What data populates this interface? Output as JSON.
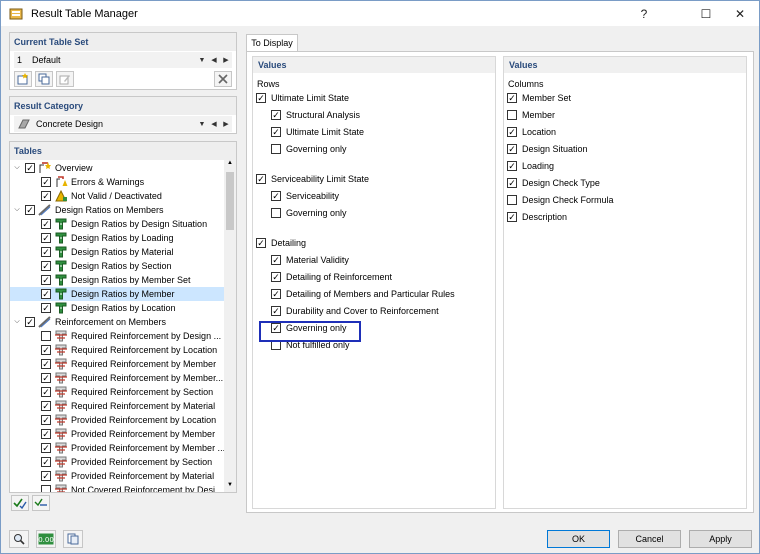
{
  "window": {
    "title": "Result Table Manager",
    "help": "?",
    "maximize": "☐",
    "close": "✕"
  },
  "current_table_set": {
    "header": "Current Table Set",
    "index": "1",
    "name": "Default"
  },
  "result_category": {
    "header": "Result Category",
    "value": "Concrete Design"
  },
  "tables": {
    "header": "Tables",
    "items": [
      {
        "label": "Overview",
        "level": 0,
        "expanded": true,
        "checked": true,
        "icon": "overview-icon"
      },
      {
        "label": "Errors & Warnings",
        "level": 1,
        "checked": true,
        "icon": "errors-warnings-icon"
      },
      {
        "label": "Not Valid / Deactivated",
        "level": 1,
        "checked": true,
        "icon": "not-valid-icon"
      },
      {
        "label": "Design Ratios on Members",
        "level": 0,
        "expanded": true,
        "checked": true,
        "icon": "member-icon"
      },
      {
        "label": "Design Ratios by Design Situation",
        "level": 1,
        "checked": true,
        "icon": "design-ratio-icon"
      },
      {
        "label": "Design Ratios by Loading",
        "level": 1,
        "checked": true,
        "icon": "design-ratio-icon"
      },
      {
        "label": "Design Ratios by Material",
        "level": 1,
        "checked": true,
        "icon": "design-ratio-icon"
      },
      {
        "label": "Design Ratios by Section",
        "level": 1,
        "checked": true,
        "icon": "design-ratio-icon"
      },
      {
        "label": "Design Ratios by Member Set",
        "level": 1,
        "checked": true,
        "icon": "design-ratio-icon"
      },
      {
        "label": "Design Ratios by Member",
        "level": 1,
        "checked": true,
        "icon": "design-ratio-icon",
        "selected": true
      },
      {
        "label": "Design Ratios by Location",
        "level": 1,
        "checked": true,
        "icon": "design-ratio-icon"
      },
      {
        "label": "Reinforcement on Members",
        "level": 0,
        "expanded": true,
        "checked": true,
        "icon": "member-icon"
      },
      {
        "label": "Required Reinforcement by Design ...",
        "level": 1,
        "checked": false,
        "icon": "reinforcement-icon"
      },
      {
        "label": "Required Reinforcement by Location",
        "level": 1,
        "checked": true,
        "icon": "reinforcement-icon"
      },
      {
        "label": "Required Reinforcement by Member",
        "level": 1,
        "checked": true,
        "icon": "reinforcement-icon"
      },
      {
        "label": "Required Reinforcement by Member...",
        "level": 1,
        "checked": true,
        "icon": "reinforcement-icon"
      },
      {
        "label": "Required Reinforcement by Section",
        "level": 1,
        "checked": true,
        "icon": "reinforcement-icon"
      },
      {
        "label": "Required Reinforcement by Material",
        "level": 1,
        "checked": true,
        "icon": "reinforcement-icon"
      },
      {
        "label": "Provided Reinforcement by Location",
        "level": 1,
        "checked": true,
        "icon": "reinforcement-icon"
      },
      {
        "label": "Provided Reinforcement by Member",
        "level": 1,
        "checked": true,
        "icon": "reinforcement-icon"
      },
      {
        "label": "Provided Reinforcement by Member ...",
        "level": 1,
        "checked": true,
        "icon": "reinforcement-icon"
      },
      {
        "label": "Provided Reinforcement by Section",
        "level": 1,
        "checked": true,
        "icon": "reinforcement-icon"
      },
      {
        "label": "Provided Reinforcement by Material",
        "level": 1,
        "checked": true,
        "icon": "reinforcement-icon"
      },
      {
        "label": "Not Covered Reinforcement by Desi...",
        "level": 1,
        "checked": false,
        "icon": "reinforcement-icon"
      }
    ]
  },
  "tab": {
    "label": "To Display"
  },
  "values_left": {
    "header": "Values",
    "rows_label": "Rows",
    "items": [
      {
        "label": "Ultimate Limit State",
        "level": 0,
        "checked": true
      },
      {
        "label": "Structural Analysis",
        "level": 1,
        "checked": true
      },
      {
        "label": "Ultimate Limit State",
        "level": 1,
        "checked": true
      },
      {
        "label": "Governing only",
        "level": 1,
        "checked": false
      },
      {
        "label": "Serviceability Limit State",
        "level": 0,
        "checked": true,
        "gap": true
      },
      {
        "label": "Serviceability",
        "level": 1,
        "checked": true
      },
      {
        "label": "Governing only",
        "level": 1,
        "checked": false
      },
      {
        "label": "Detailing",
        "level": 0,
        "checked": true,
        "gap": true
      },
      {
        "label": "Material Validity",
        "level": 1,
        "checked": true
      },
      {
        "label": "Detailing of Reinforcement",
        "level": 1,
        "checked": true
      },
      {
        "label": "Detailing of Members and Particular Rules",
        "level": 1,
        "checked": true
      },
      {
        "label": "Durability and Cover to Reinforcement",
        "level": 1,
        "checked": true
      },
      {
        "label": "Governing only",
        "level": 1,
        "checked": true
      },
      {
        "label": "Not fulfilled only",
        "level": 1,
        "checked": false
      }
    ]
  },
  "values_right": {
    "header": "Values",
    "columns_label": "Columns",
    "items": [
      {
        "label": "Member Set",
        "checked": true
      },
      {
        "label": "Member",
        "checked": false
      },
      {
        "label": "Location",
        "checked": true
      },
      {
        "label": "Design Situation",
        "checked": true
      },
      {
        "label": "Loading",
        "checked": true
      },
      {
        "label": "Design Check Type",
        "checked": true
      },
      {
        "label": "Design Check Formula",
        "checked": false
      },
      {
        "label": "Description",
        "checked": true
      }
    ]
  },
  "buttons": {
    "ok": "OK",
    "cancel": "Cancel",
    "apply": "Apply"
  },
  "colors": {
    "accent": "#2a4b7c",
    "highlight": "#1e2fb8",
    "selected_row": "#cce6ff"
  }
}
